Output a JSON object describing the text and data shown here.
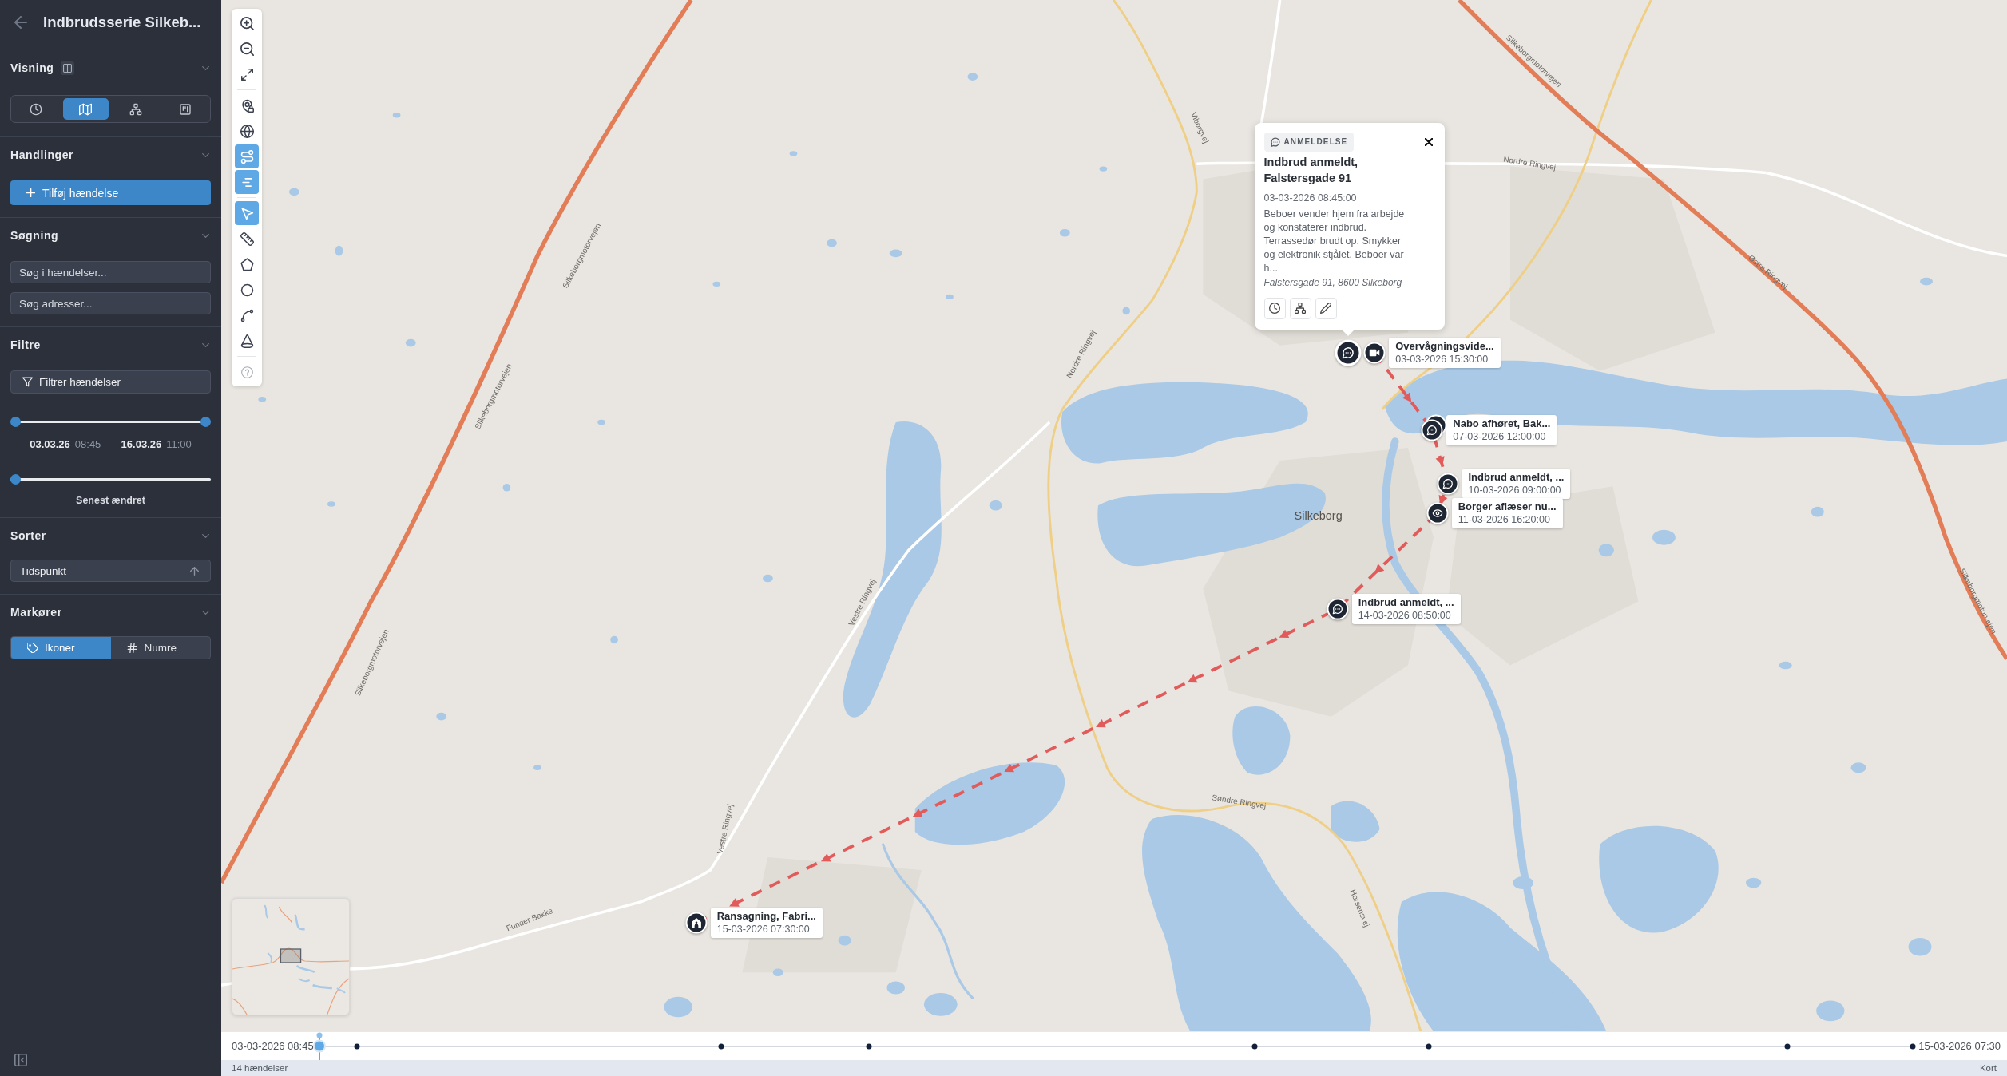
{
  "sidebar": {
    "title": "Indbrudsserie Silkeb...",
    "view_section": {
      "heading": "Visning",
      "views": [
        {
          "selected": false
        },
        {
          "selected": true
        },
        {
          "selected": false
        },
        {
          "selected": false
        }
      ]
    },
    "actions_section": {
      "heading": "Handlinger",
      "add_button": "Tilføj hændelse"
    },
    "search_section": {
      "heading": "Søgning",
      "fields": [
        {
          "placeholder": "Søg i hændelser..."
        },
        {
          "placeholder": "Søg adresser..."
        }
      ]
    },
    "filter_section": {
      "heading": "Filtre",
      "filter_button": "Filtrer hændelser",
      "date_range": {
        "thumbs": [
          {
            "level": 0
          },
          {
            "level": 1
          }
        ],
        "start_date": "03.03.26",
        "start_time": "08:45",
        "separator": "–",
        "end_date": "16.03.26",
        "end_time": "11:00"
      },
      "modified_slider": {
        "level": 0,
        "label": "Senest ændret"
      }
    },
    "sort_section": {
      "heading": "Sorter",
      "select": "Tidspunkt"
    },
    "markers_section": {
      "heading": "Markører",
      "options": [
        {
          "label": "Ikoner",
          "selected": true
        },
        {
          "label": "Numre",
          "selected": false
        }
      ]
    }
  },
  "map_toolbar": {
    "layers": [
      {
        "on": false
      },
      {
        "on": false
      },
      {
        "on": true
      },
      {
        "on": true
      }
    ],
    "tools": [
      {
        "selected": true
      },
      {
        "selected": false
      },
      {
        "selected": false
      },
      {
        "selected": false
      },
      {
        "selected": false
      },
      {
        "selected": false
      }
    ]
  },
  "map": {
    "labels": [
      {
        "text": "Silkeborgmotorvejen",
        "kind": "road"
      },
      {
        "text": "Silkeborgmotorvejen",
        "kind": "road"
      },
      {
        "text": "Silkeborgmotorvejen",
        "kind": "road"
      },
      {
        "text": "Viborgvej",
        "kind": "road"
      },
      {
        "text": "Nordre Ringvej",
        "kind": "road"
      },
      {
        "text": "Silkeborgmotorvejen",
        "kind": "road"
      },
      {
        "text": "Østre Ringvej",
        "kind": "road"
      },
      {
        "text": "Nordre Ringvej",
        "kind": "road"
      },
      {
        "text": "Silkeborg",
        "kind": "place"
      },
      {
        "text": "Silkeborgmotorvejen",
        "kind": "road"
      },
      {
        "text": "Vestre Ringvej",
        "kind": "road"
      },
      {
        "text": "Vestre Ringvej",
        "kind": "road"
      },
      {
        "text": "Søndre Ringvej",
        "kind": "road"
      },
      {
        "text": "Horsensvej",
        "kind": "road"
      },
      {
        "text": "Funder Bakke",
        "kind": "road"
      }
    ],
    "markers": [
      {
        "kind": "report",
        "selected": true,
        "stacked": false
      },
      {
        "kind": "video",
        "selected": false,
        "stacked": false,
        "title": "Overvågningsvide...",
        "time": "03-03-2026 15:30:00"
      },
      {
        "kind": "report",
        "selected": false,
        "stacked": true,
        "title": "Nabo afhøret, Bak...",
        "time": "07-03-2026 12:00:00"
      },
      {
        "kind": "report",
        "selected": false,
        "stacked": false,
        "title": "Indbrud anmeldt, ...",
        "time": "10-03-2026 09:00:00"
      },
      {
        "kind": "observation",
        "selected": false,
        "stacked": false,
        "title": "Borger aflæser nu...",
        "time": "11-03-2026 16:20:00"
      },
      {
        "kind": "report",
        "selected": false,
        "stacked": false,
        "title": "Indbrud anmeldt, ...",
        "time": "14-03-2026 08:50:00"
      },
      {
        "kind": "search",
        "selected": false,
        "stacked": false,
        "title": "Ransagning, Fabri...",
        "time": "15-03-2026 07:30:00"
      }
    ],
    "popup": {
      "tag": "ANMELDELSE",
      "title": "Indbrud anmeldt, Falstersgade 91",
      "time": "03-03-2026 08:45:00",
      "description": "Beboer vender hjem fra arbejde og konstaterer indbrud. Terrassedør brudt op. Smykker og elektronik stjålet. Beboer var h...",
      "address": "Falstersgade 91, 8600 Silkeborg"
    }
  },
  "timeline": {
    "start": "03-03-2026 08:45",
    "end": "15-03-2026 07:30",
    "level": 0
  },
  "status_bar": {
    "count": "14 hændelser",
    "view": "Kort"
  }
}
